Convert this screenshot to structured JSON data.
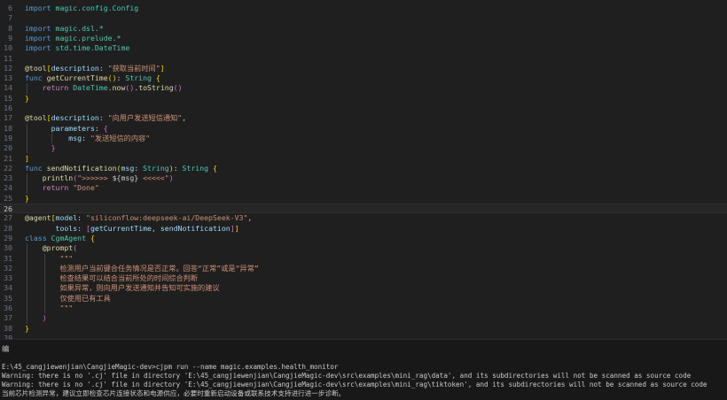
{
  "editor": {
    "lines": [
      {
        "n": "6",
        "tokens": [
          [
            "kw",
            "import"
          ],
          [
            "plain",
            " "
          ],
          [
            "ty",
            "magic.config.Config"
          ]
        ]
      },
      {
        "n": "7",
        "tokens": []
      },
      {
        "n": "8",
        "tokens": [
          [
            "kw",
            "import"
          ],
          [
            "plain",
            " "
          ],
          [
            "ty",
            "magic.dsl.*"
          ]
        ]
      },
      {
        "n": "9",
        "tokens": [
          [
            "kw",
            "import"
          ],
          [
            "plain",
            " "
          ],
          [
            "ty",
            "magic.prelude.*"
          ]
        ]
      },
      {
        "n": "10",
        "tokens": [
          [
            "kw",
            "import"
          ],
          [
            "plain",
            " "
          ],
          [
            "ty",
            "std.time.DateTime"
          ]
        ]
      },
      {
        "n": "11",
        "tokens": []
      },
      {
        "n": "12",
        "tokens": [
          [
            "ann",
            "@tool"
          ],
          [
            "brk1",
            "["
          ],
          [
            "prm",
            "description"
          ],
          [
            "plain",
            ": "
          ],
          [
            "str",
            "\"获取当前时间\""
          ],
          [
            "brk1",
            "]"
          ]
        ]
      },
      {
        "n": "13",
        "tokens": [
          [
            "kw",
            "func"
          ],
          [
            "plain",
            " "
          ],
          [
            "fn",
            "getCurrentTime"
          ],
          [
            "brk1",
            "()"
          ],
          [
            "plain",
            ": "
          ],
          [
            "ty",
            "String"
          ],
          [
            "plain",
            " "
          ],
          [
            "brk1",
            "{"
          ]
        ]
      },
      {
        "n": "14",
        "tokens": [
          [
            "plain",
            "    "
          ],
          [
            "ctl",
            "return"
          ],
          [
            "plain",
            " "
          ],
          [
            "ty",
            "DateTime"
          ],
          [
            "plain",
            "."
          ],
          [
            "fn",
            "now"
          ],
          [
            "brk2",
            "()"
          ],
          [
            "plain",
            "."
          ],
          [
            "fn",
            "toString"
          ],
          [
            "brk2",
            "()"
          ]
        ]
      },
      {
        "n": "15",
        "tokens": [
          [
            "brk1",
            "}"
          ]
        ]
      },
      {
        "n": "16",
        "tokens": []
      },
      {
        "n": "17",
        "tokens": [
          [
            "ann",
            "@tool"
          ],
          [
            "brk1",
            "["
          ],
          [
            "prm",
            "description"
          ],
          [
            "plain",
            ": "
          ],
          [
            "str",
            "\"向用户发送短信通知\""
          ],
          [
            "plain",
            ","
          ]
        ]
      },
      {
        "n": "18",
        "tokens": [
          [
            "plain",
            "      "
          ],
          [
            "prm",
            "parameters"
          ],
          [
            "plain",
            ": "
          ],
          [
            "brk2",
            "{"
          ]
        ]
      },
      {
        "n": "19",
        "tokens": [
          [
            "plain",
            "          "
          ],
          [
            "prm",
            "msg"
          ],
          [
            "plain",
            ": "
          ],
          [
            "str",
            "\"发送短信的内容\""
          ]
        ]
      },
      {
        "n": "20",
        "tokens": [
          [
            "plain",
            "      "
          ],
          [
            "brk2",
            "}"
          ]
        ]
      },
      {
        "n": "21",
        "tokens": [
          [
            "brk1",
            "]"
          ]
        ]
      },
      {
        "n": "22",
        "tokens": [
          [
            "kw",
            "func"
          ],
          [
            "plain",
            " "
          ],
          [
            "fn",
            "sendNotification"
          ],
          [
            "brk1",
            "("
          ],
          [
            "prm",
            "msg"
          ],
          [
            "plain",
            ": "
          ],
          [
            "ty",
            "String"
          ],
          [
            "brk1",
            ")"
          ],
          [
            "plain",
            ": "
          ],
          [
            "ty",
            "String"
          ],
          [
            "plain",
            " "
          ],
          [
            "brk1",
            "{"
          ]
        ]
      },
      {
        "n": "23",
        "tokens": [
          [
            "plain",
            "    "
          ],
          [
            "fn",
            "println"
          ],
          [
            "brk2",
            "("
          ],
          [
            "str",
            "\">>>>>> "
          ],
          [
            "plain",
            "${msg}"
          ],
          [
            "str",
            " <<<<<\""
          ],
          [
            "brk2",
            ")"
          ]
        ]
      },
      {
        "n": "24",
        "tokens": [
          [
            "plain",
            "    "
          ],
          [
            "ctl",
            "return"
          ],
          [
            "plain",
            " "
          ],
          [
            "str",
            "\"Done\""
          ]
        ]
      },
      {
        "n": "25",
        "tokens": [
          [
            "brk1",
            "}"
          ]
        ]
      },
      {
        "n": "26",
        "tokens": [],
        "current": true
      },
      {
        "n": "27",
        "tokens": [
          [
            "ann",
            "@agent"
          ],
          [
            "brk1",
            "["
          ],
          [
            "prm",
            "model"
          ],
          [
            "plain",
            ": "
          ],
          [
            "str",
            "\"siliconflow:deepseek-ai/DeepSeek-V3\""
          ],
          [
            "plain",
            ","
          ]
        ]
      },
      {
        "n": "28",
        "tokens": [
          [
            "plain",
            "       "
          ],
          [
            "prm",
            "tools"
          ],
          [
            "plain",
            ": "
          ],
          [
            "brk2",
            "["
          ],
          [
            "prm",
            "getCurrentTime"
          ],
          [
            "plain",
            ", "
          ],
          [
            "prm",
            "sendNotification"
          ],
          [
            "brk2",
            "]"
          ],
          [
            "brk1",
            "]"
          ]
        ]
      },
      {
        "n": "29",
        "tokens": [
          [
            "kw",
            "class"
          ],
          [
            "plain",
            " "
          ],
          [
            "ty",
            "CgmAgent"
          ],
          [
            "plain",
            " "
          ],
          [
            "brk1",
            "{"
          ]
        ]
      },
      {
        "n": "30",
        "tokens": [
          [
            "plain",
            "    "
          ],
          [
            "ann",
            "@prompt"
          ],
          [
            "brk2",
            "("
          ]
        ]
      },
      {
        "n": "31",
        "tokens": [
          [
            "plain",
            "        "
          ],
          [
            "str",
            "\"\"\""
          ]
        ]
      },
      {
        "n": "32",
        "tokens": [
          [
            "plain",
            "        "
          ],
          [
            "str",
            "检测用户当前键合任务情况是否正常。回答“正常”或是“异常”"
          ]
        ]
      },
      {
        "n": "33",
        "tokens": [
          [
            "plain",
            "        "
          ],
          [
            "str",
            "检查结果可以结合当前所处的时间综合判断"
          ]
        ]
      },
      {
        "n": "34",
        "tokens": [
          [
            "plain",
            "        "
          ],
          [
            "str",
            "如果异常，则向用户发送通知并告知可实施的建议"
          ]
        ]
      },
      {
        "n": "35",
        "tokens": [
          [
            "plain",
            "        "
          ],
          [
            "str",
            "仅使用已有工具"
          ]
        ]
      },
      {
        "n": "36",
        "tokens": [
          [
            "plain",
            "        "
          ],
          [
            "str",
            "\"\"\""
          ]
        ]
      },
      {
        "n": "37",
        "tokens": [
          [
            "plain",
            "    "
          ],
          [
            "brk2",
            ")"
          ]
        ]
      },
      {
        "n": "38",
        "tokens": [
          [
            "brk1",
            "}"
          ]
        ]
      },
      {
        "n": "39",
        "tokens": []
      }
    ]
  },
  "panel": {
    "tab_label": "编",
    "terminal": [
      "E:\\45_cangjiewenjian\\CangjieMagic-dev>cjpm run --name magic.examples.health_monitor",
      "Warning: there is no '.cj' file in directory 'E:\\45_cangjiewenjian\\CangjieMagic-dev\\src\\examples\\mini_rag\\data', and its subdirectories will not be scanned as source code",
      "Warning: there is no '.cj' file in directory 'E:\\45_cangjiewenjian\\CangjieMagic-dev\\src\\examples\\mini_rag\\tiktoken', and its subdirectories will not be scanned as source code",
      "当前芯片检测异常，建议立即检查芯片连接状态和电源供应，必要时重新启动设备或联系技术支持进行进一步诊断。"
    ]
  }
}
